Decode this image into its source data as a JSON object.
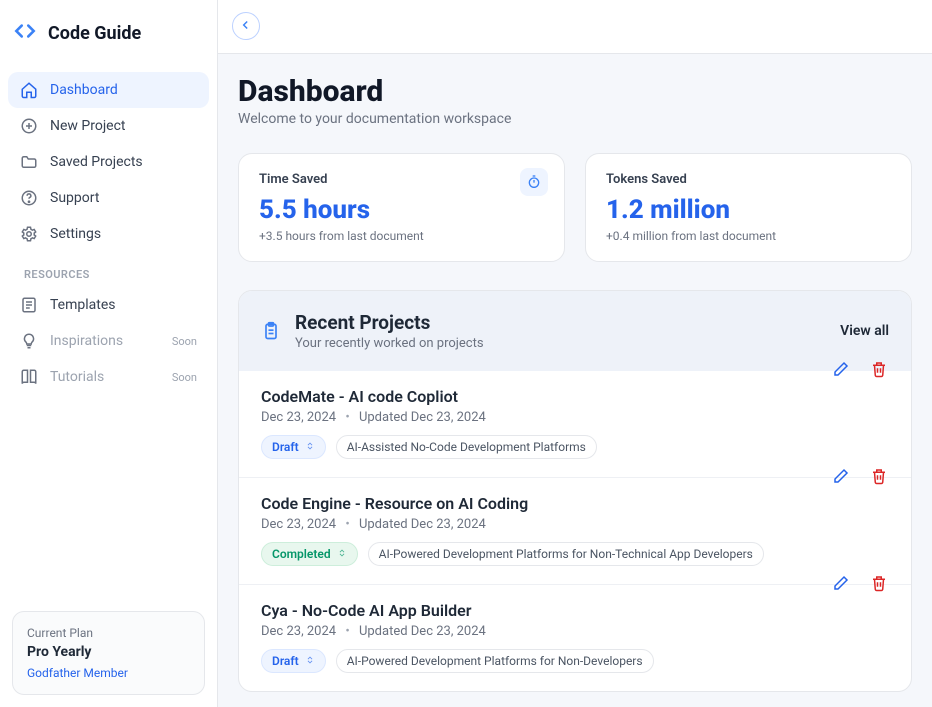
{
  "brand": {
    "name": "Code Guide"
  },
  "sidebar": {
    "items": [
      {
        "label": "Dashboard"
      },
      {
        "label": "New Project"
      },
      {
        "label": "Saved Projects"
      },
      {
        "label": "Support"
      },
      {
        "label": "Settings"
      }
    ],
    "resources_label": "RESOURCES",
    "resources": [
      {
        "label": "Templates",
        "badge": ""
      },
      {
        "label": "Inspirations",
        "badge": "Soon"
      },
      {
        "label": "Tutorials",
        "badge": "Soon"
      }
    ]
  },
  "plan": {
    "label": "Current Plan",
    "name": "Pro Yearly",
    "sub": "Godfather Member"
  },
  "page": {
    "title": "Dashboard",
    "subtitle": "Welcome to your documentation workspace"
  },
  "stats": [
    {
      "label": "Time Saved",
      "value": "5.5 hours",
      "delta": "+3.5 hours from last document"
    },
    {
      "label": "Tokens Saved",
      "value": "1.2 million",
      "delta": "+0.4 million from last document"
    }
  ],
  "recent": {
    "title": "Recent Projects",
    "subtitle": "Your recently worked on projects",
    "view_all": "View all",
    "projects": [
      {
        "title": "CodeMate - AI code Copliot",
        "date": "Dec 23, 2024",
        "updated": "Updated Dec 23, 2024",
        "status": "Draft",
        "status_kind": "draft",
        "tag": "AI-Assisted No-Code Development Platforms"
      },
      {
        "title": "Code Engine - Resource on AI Coding",
        "date": "Dec 23, 2024",
        "updated": "Updated Dec 23, 2024",
        "status": "Completed",
        "status_kind": "completed",
        "tag": "AI-Powered Development Platforms for Non-Technical App Developers"
      },
      {
        "title": "Cya - No-Code AI App Builder",
        "date": "Dec 23, 2024",
        "updated": "Updated Dec 23, 2024",
        "status": "Draft",
        "status_kind": "draft",
        "tag": "AI-Powered Development Platforms for Non-Developers"
      }
    ]
  }
}
